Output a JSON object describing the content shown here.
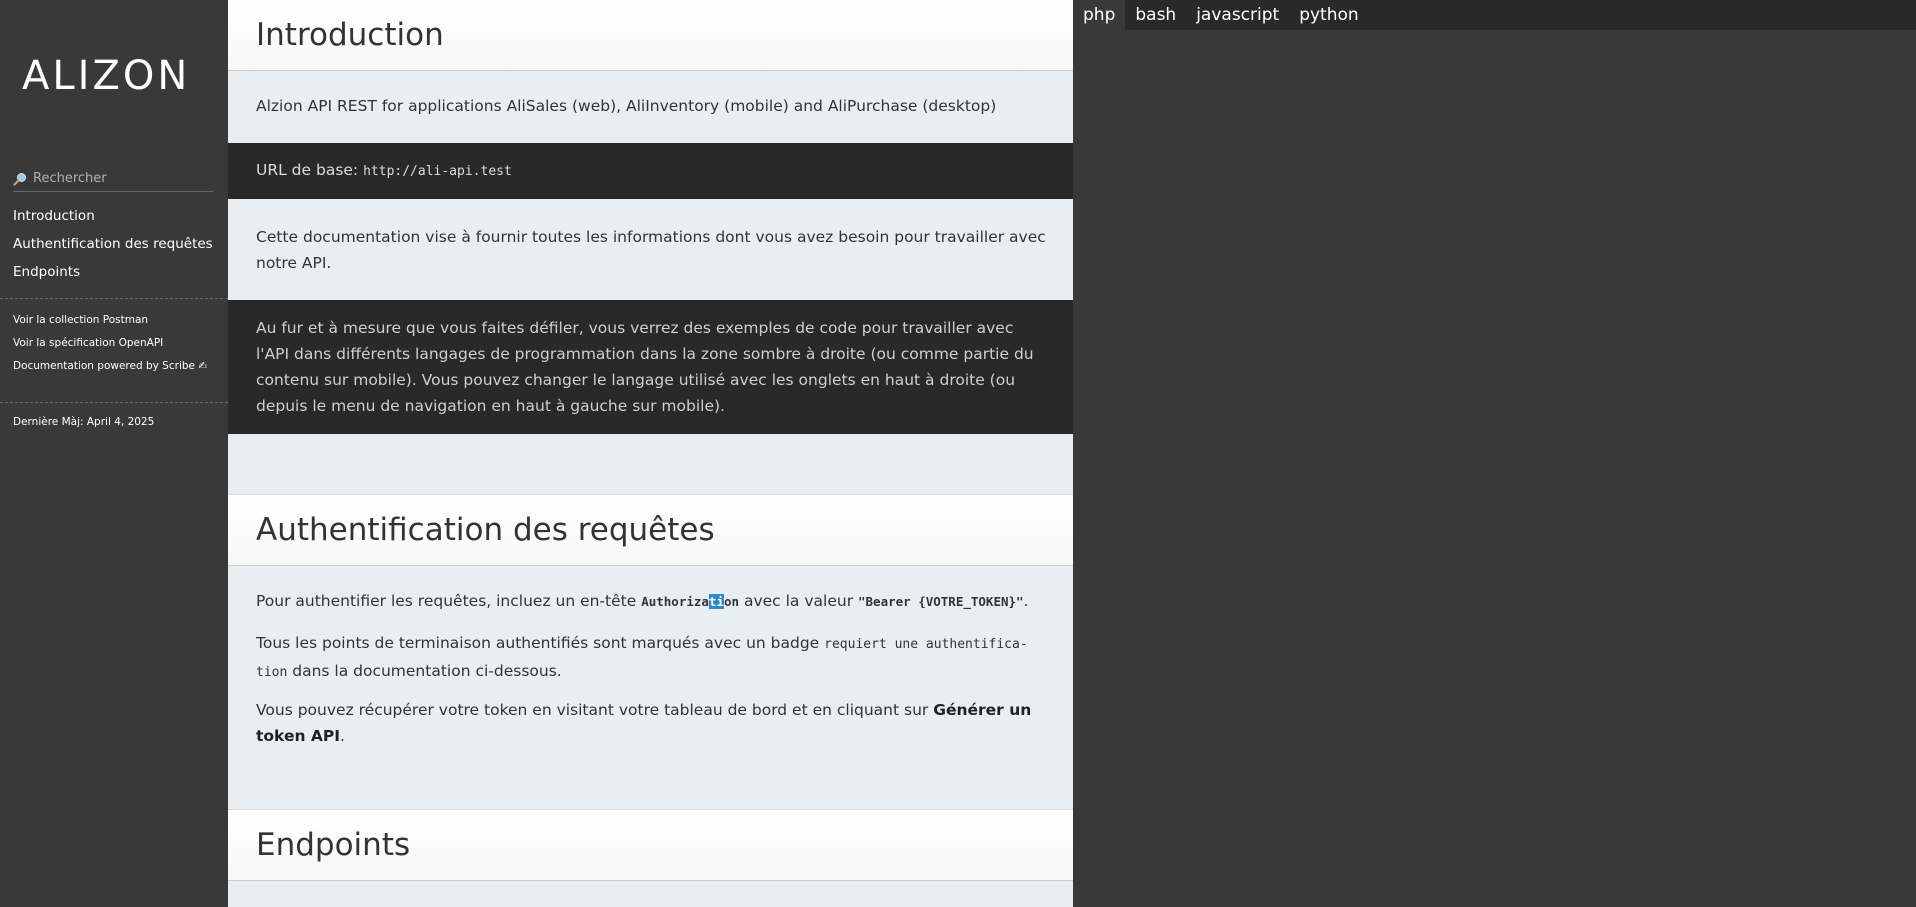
{
  "sidebar": {
    "logo": "ALIZON",
    "search_placeholder": "Rechercher",
    "toc": [
      {
        "label": "Introduction"
      },
      {
        "label": "Authentification des requêtes"
      },
      {
        "label": "Endpoints"
      }
    ],
    "links": [
      {
        "label": "Voir la collection Postman"
      },
      {
        "label": "Voir la spécification OpenAPI"
      },
      {
        "label": "Documentation powered by Scribe ✍"
      }
    ],
    "last_updated": "Dernière Màj: April 4, 2025"
  },
  "intro": {
    "heading": "Introduction",
    "description": "Alzion API REST for applications AliSales (web), AliInventory (mobile) and AliPurchase (desktop)",
    "base_url_label": "URL de base:",
    "base_url": "http://ali-api.test",
    "doc_text": "Cette documentation vise à fournir toutes les informations dont vous avez besoin pour travailler avec notre API.",
    "code_note": "Au fur et à mesure que vous faites défiler, vous verrez des exemples de code pour travailler avec l'API dans différents langages de programmation dans la zone sombre à droite (ou comme partie du contenu sur mobile). Vous pouvez changer le langage utilisé avec les onglets en haut à droite (ou depuis le menu de navigation en haut à gauche sur mobile)."
  },
  "auth": {
    "heading": "Authentification des requêtes",
    "p1_before": "Pour authentifier les requêtes, incluez un en-tête ",
    "p1_header_a": "Authoriza",
    "p1_header_b": "ti",
    "p1_header_c": "on",
    "p1_middle": " avec la valeur ",
    "p1_value": "\"Bearer {VOTRE_TOKEN}\"",
    "p1_after": ".",
    "p2_before": "Tous les points de terminaison authentifiés sont marqués avec un badge ",
    "p2_badge_line1": "requiert une authentifica-",
    "p2_badge_line2": "tion",
    "p2_after": " dans la documentation ci-dessous.",
    "p3_before": "Vous pouvez récupérer votre token en visitant votre tableau de bord et en cliquant sur ",
    "p3_strong": "Générer un token API",
    "p3_after": "."
  },
  "endpoints": {
    "heading": "Endpoints"
  },
  "code_tabs": [
    {
      "label": "php",
      "active": true
    },
    {
      "label": "bash",
      "active": false
    },
    {
      "label": "javascript",
      "active": false
    },
    {
      "label": "python",
      "active": false
    }
  ]
}
